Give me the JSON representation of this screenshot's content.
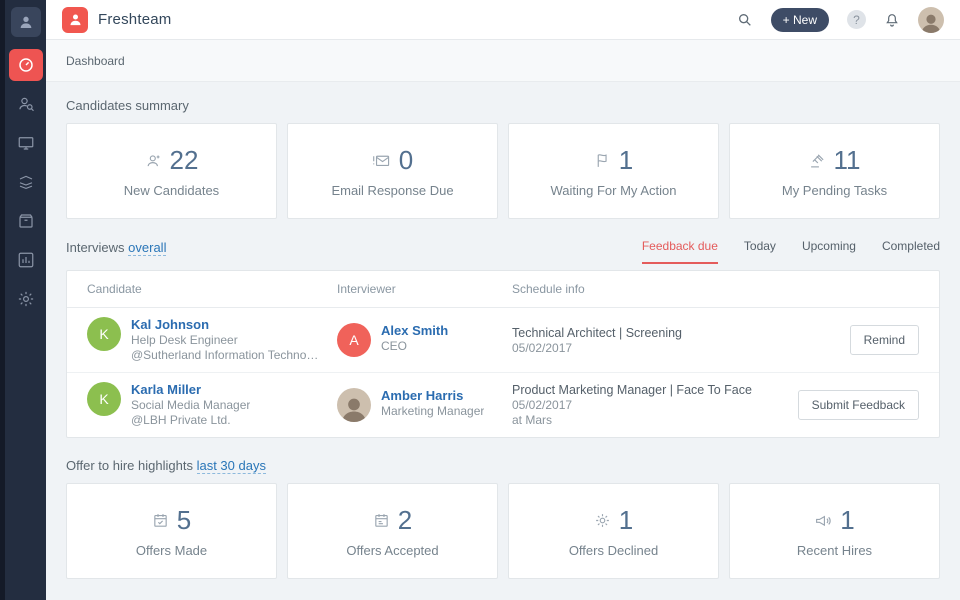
{
  "colors": {
    "brand_red": "#f1574f",
    "sidebar_bg": "#232d40",
    "sidebar_active_red": "#ee5452",
    "link_blue": "#2a76b8",
    "name_link_blue": "#2b6cb0",
    "stat_number_blue": "#53708f",
    "tab_active_red": "#e45b5b",
    "avatar_green": "#8cbf4f",
    "avatar_red": "#f0625a",
    "new_button_bg": "#3e4c66"
  },
  "sidebar": {
    "items": [
      {
        "name": "org-avatar"
      },
      {
        "name": "dashboard",
        "active": true
      },
      {
        "name": "candidates"
      },
      {
        "name": "screen-share"
      },
      {
        "name": "onboarding"
      },
      {
        "name": "employee-directory"
      },
      {
        "name": "reports"
      },
      {
        "name": "settings"
      }
    ]
  },
  "header": {
    "app_name": "Freshteam",
    "new_button_label": "+ New",
    "help_label": "?"
  },
  "breadcrumb": {
    "label": "Dashboard"
  },
  "candidates_summary": {
    "title": "Candidates summary",
    "cards": [
      {
        "value": "22",
        "label": "New Candidates",
        "icon": "user-plus-icon"
      },
      {
        "value": "0",
        "label": "Email Response Due",
        "icon": "envelope-alert-icon"
      },
      {
        "value": "1",
        "label": "Waiting For My Action",
        "icon": "flag-icon"
      },
      {
        "value": "11",
        "label": "My Pending Tasks",
        "icon": "gavel-icon"
      }
    ]
  },
  "interviews": {
    "title": "Interviews",
    "filter_link": "overall",
    "tabs": [
      {
        "label": "Feedback due",
        "active": true
      },
      {
        "label": "Today",
        "active": false
      },
      {
        "label": "Upcoming",
        "active": false
      },
      {
        "label": "Completed",
        "active": false
      }
    ],
    "columns": {
      "candidate": "Candidate",
      "interviewer": "Interviewer",
      "schedule": "Schedule info"
    },
    "rows": [
      {
        "candidate": {
          "initial": "K",
          "name": "Kal Johnson",
          "role": "Help Desk Engineer",
          "company": "@Sutherland Information Technolo..."
        },
        "interviewer": {
          "initial": "A",
          "name": "Alex Smith",
          "role": "CEO"
        },
        "schedule": {
          "position": "Technical Architect | Screening",
          "date": "05/02/2017",
          "location": ""
        },
        "action_label": "Remind"
      },
      {
        "candidate": {
          "initial": "K",
          "name": "Karla Miller",
          "role": "Social Media Manager",
          "company": "@LBH Private Ltd."
        },
        "interviewer": {
          "initial": "",
          "name": "Amber Harris",
          "role": "Marketing Manager"
        },
        "schedule": {
          "position": "Product Marketing Manager | Face To Face",
          "date": "05/02/2017",
          "location": "at Mars"
        },
        "action_label": "Submit Feedback"
      }
    ]
  },
  "offer_highlights": {
    "title": "Offer to hire highlights",
    "filter_link": "last 30 days",
    "cards": [
      {
        "value": "5",
        "label": "Offers Made",
        "icon": "calendar-check-icon"
      },
      {
        "value": "2",
        "label": "Offers Accepted",
        "icon": "calendar-icon"
      },
      {
        "value": "1",
        "label": "Offers Declined",
        "icon": "gear-flower-icon"
      },
      {
        "value": "1",
        "label": "Recent Hires",
        "icon": "megaphone-icon"
      }
    ]
  }
}
